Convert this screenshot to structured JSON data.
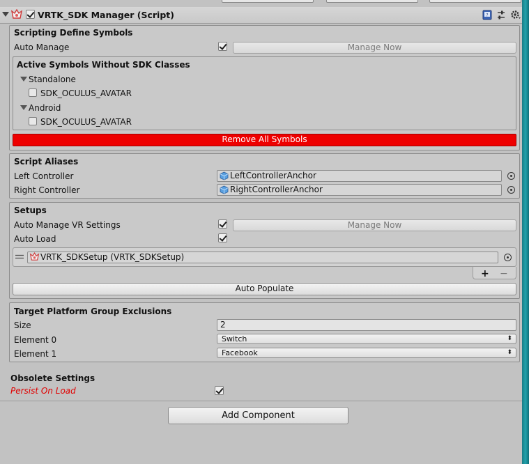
{
  "header": {
    "enabled": true,
    "title": "VRTK_SDK Manager (Script)"
  },
  "scripting_define_symbols": {
    "title": "Scripting Define Symbols",
    "auto_manage_label": "Auto Manage",
    "auto_manage_checked": true,
    "manage_now_label": "Manage Now",
    "active_symbols": {
      "title": "Active Symbols Without SDK Classes",
      "groups": [
        {
          "platform": "Standalone",
          "symbol": "SDK_OCULUS_AVATAR",
          "checked": false
        },
        {
          "platform": "Android",
          "symbol": "SDK_OCULUS_AVATAR",
          "checked": false
        }
      ]
    },
    "remove_all_label": "Remove All Symbols"
  },
  "script_aliases": {
    "title": "Script Aliases",
    "left_label": "Left Controller",
    "left_value": "LeftControllerAnchor",
    "right_label": "Right Controller",
    "right_value": "RightControllerAnchor"
  },
  "setups": {
    "title": "Setups",
    "auto_manage_vr_label": "Auto Manage VR Settings",
    "auto_manage_vr_checked": true,
    "manage_now_label": "Manage Now",
    "auto_load_label": "Auto Load",
    "auto_load_checked": true,
    "list_item": "VRTK_SDKSetup (VRTK_SDKSetup)",
    "add_symbol": "+",
    "remove_symbol": "−",
    "auto_populate_label": "Auto Populate"
  },
  "target_platform": {
    "title": "Target Platform Group Exclusions",
    "size_label": "Size",
    "size_value": "2",
    "elements": [
      {
        "label": "Element 0",
        "value": "Switch"
      },
      {
        "label": "Element 1",
        "value": "Facebook"
      }
    ],
    "dropdown_arrow": "⬍"
  },
  "obsolete": {
    "title": "Obsolete Settings",
    "persist_label": "Persist On Load",
    "persist_checked": true
  },
  "add_component_label": "Add Component",
  "colors": {
    "panel_bg": "#c2c2c2",
    "remove_button": "#ee0000",
    "obsolete_text": "#e00000",
    "accent_strip": "#22a2ac"
  }
}
